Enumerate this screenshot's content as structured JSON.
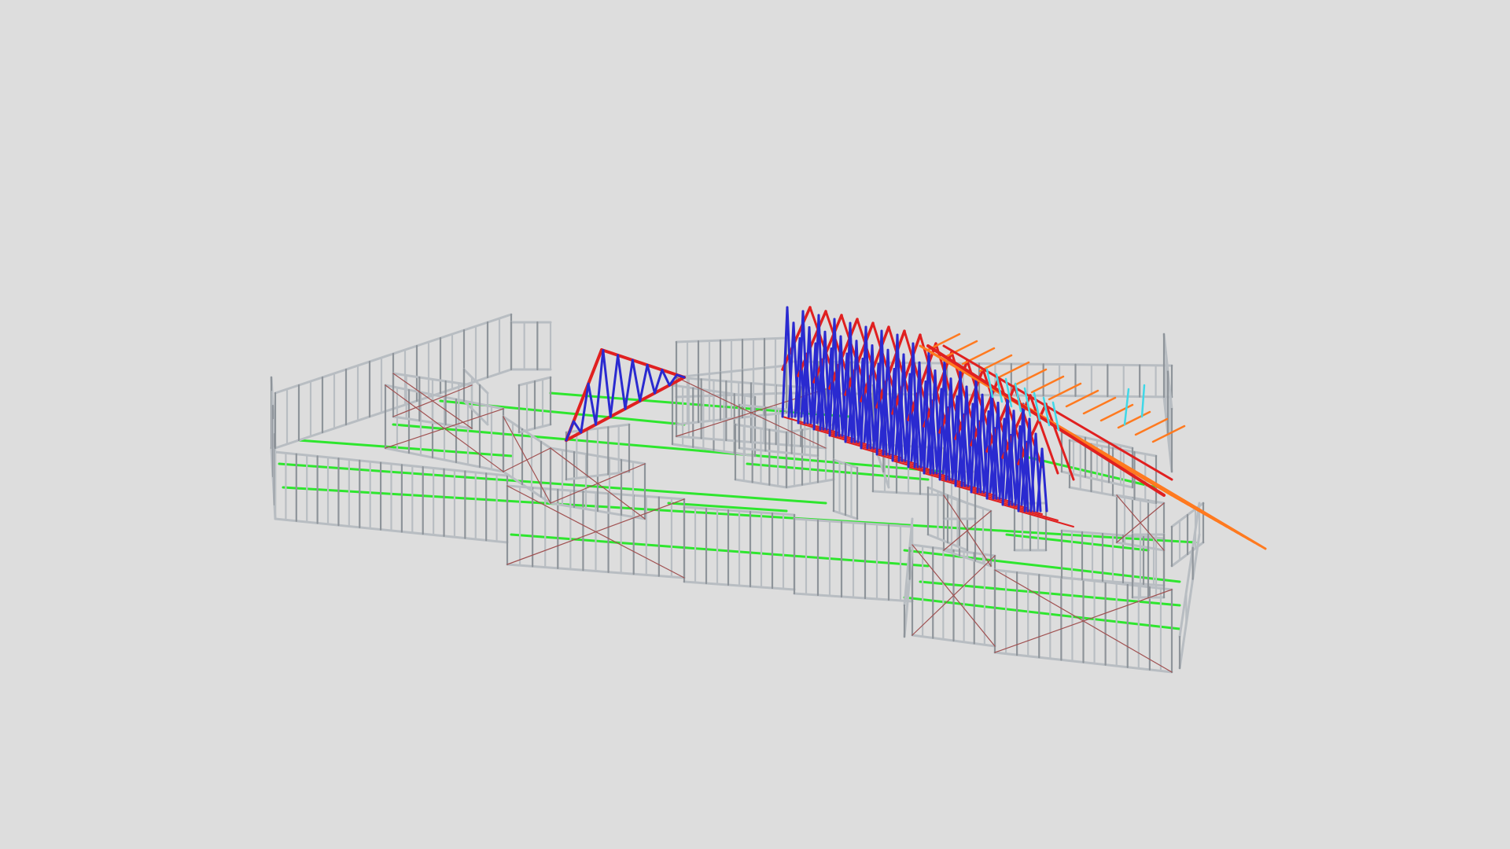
{
  "viewer": {
    "background_color": "#dddddd"
  },
  "model": {
    "type": "steel-frame-house-3d-model",
    "colors": {
      "wall_stud": "#b8bdc2",
      "wall_stud_dark": "#8e949a",
      "floor_beam": "#2ee62e",
      "wall_brace": "#a05050",
      "truss_chord": "#e02020",
      "truss_web": "#2a2ad0",
      "roof_batten": "#ff7a20",
      "roof_accent": "#40d8e8"
    }
  }
}
